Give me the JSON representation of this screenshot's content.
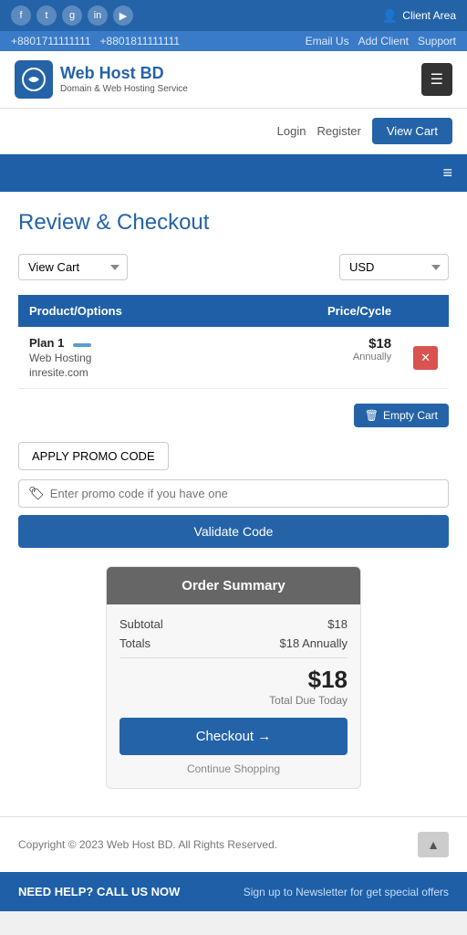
{
  "topBar": {
    "icons": [
      "f",
      "t",
      "g+",
      "in",
      "yt"
    ],
    "clientArea": "Client Area"
  },
  "secondaryBar": {
    "phone1": "+8801711111111",
    "phone2": "+8801811111111",
    "email": "Email Us",
    "addClient": "Add Client",
    "support": "Support"
  },
  "header": {
    "logoAlt": "Web Host BD",
    "brand": "Web Host BD",
    "tagline": "Domain & Web Hosting Service",
    "hamburgerLabel": "☰"
  },
  "authBar": {
    "loginLabel": "Login",
    "registerLabel": "Register",
    "viewCartLabel": "View Cart"
  },
  "navMenuBar": {
    "icon": "≡"
  },
  "page": {
    "title": "Review & Checkout"
  },
  "dropdowns": {
    "viewCartOptions": [
      "View Cart"
    ],
    "currencyOptions": [
      "USD"
    ],
    "selectedViewCart": "View Cart",
    "selectedCurrency": "USD"
  },
  "cartTable": {
    "headers": {
      "productOptions": "Product/Options",
      "priceCycle": "Price/Cycle"
    },
    "items": [
      {
        "name": "Plan 1",
        "tag": "",
        "subLine1": "Web Hosting",
        "subLine2": "inresite.com",
        "price": "$18",
        "cycle": "Annually"
      }
    ]
  },
  "emptyCartButton": "Empty Cart",
  "promo": {
    "applyLabel": "APPLY PROMO CODE",
    "placeholder": "Enter promo code if you have one",
    "validateLabel": "Validate Code"
  },
  "orderSummary": {
    "header": "Order Summary",
    "subtotalLabel": "Subtotal",
    "subtotalValue": "$18",
    "totalsLabel": "Totals",
    "totalsValue": "$18 Annually",
    "totalAmount": "$18",
    "totalDueLabel": "Total Due Today",
    "checkoutLabel": "Checkout →",
    "continueLabel": "Continue Shopping"
  },
  "footer": {
    "copyright": "Copyright © 2023 Web Host BD. All Rights Reserved.",
    "scrollTopIcon": "▲"
  },
  "bottomBar": {
    "needHelp": "NEED HELP? CALL US NOW",
    "newsletter": "Sign up to Newsletter for get special offers"
  }
}
